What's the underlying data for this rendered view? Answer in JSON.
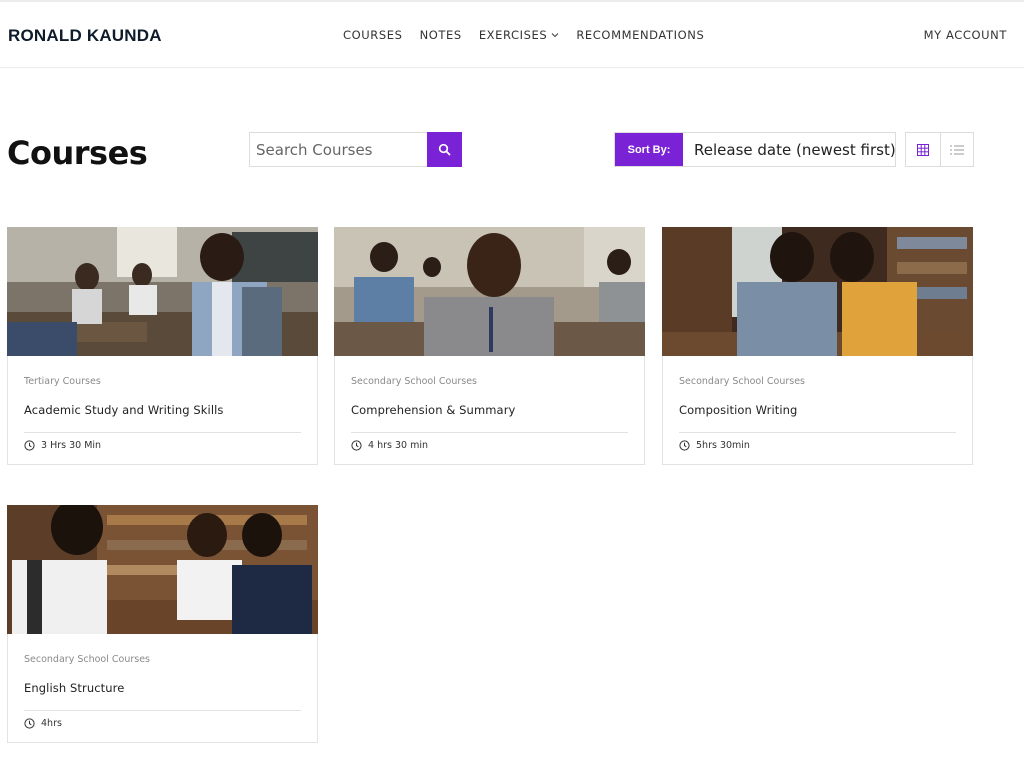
{
  "brand": "RONALD KAUNDA",
  "nav": {
    "items": [
      {
        "label": "COURSES"
      },
      {
        "label": "NOTES"
      },
      {
        "label": "EXERCISES"
      },
      {
        "label": "RECOMMENDATIONS"
      }
    ],
    "account": "MY ACCOUNT"
  },
  "page": {
    "title": "Courses"
  },
  "search": {
    "placeholder": "Search Courses",
    "value": ""
  },
  "sort": {
    "label": "Sort By:",
    "value": "Release date (newest first)"
  },
  "view": {
    "active": "grid"
  },
  "colors": {
    "accent": "#7a22d6"
  },
  "courses": [
    {
      "category": "Tertiary Courses",
      "title": "Academic Study and Writing Skills",
      "duration": "3 Hrs 30 Min"
    },
    {
      "category": "Secondary School Courses",
      "title": "Comprehension & Summary",
      "duration": "4 hrs 30 min"
    },
    {
      "category": "Secondary School Courses",
      "title": "Composition Writing",
      "duration": "5hrs 30min"
    },
    {
      "category": "Secondary School Courses",
      "title": "English Structure",
      "duration": "4hrs"
    }
  ]
}
